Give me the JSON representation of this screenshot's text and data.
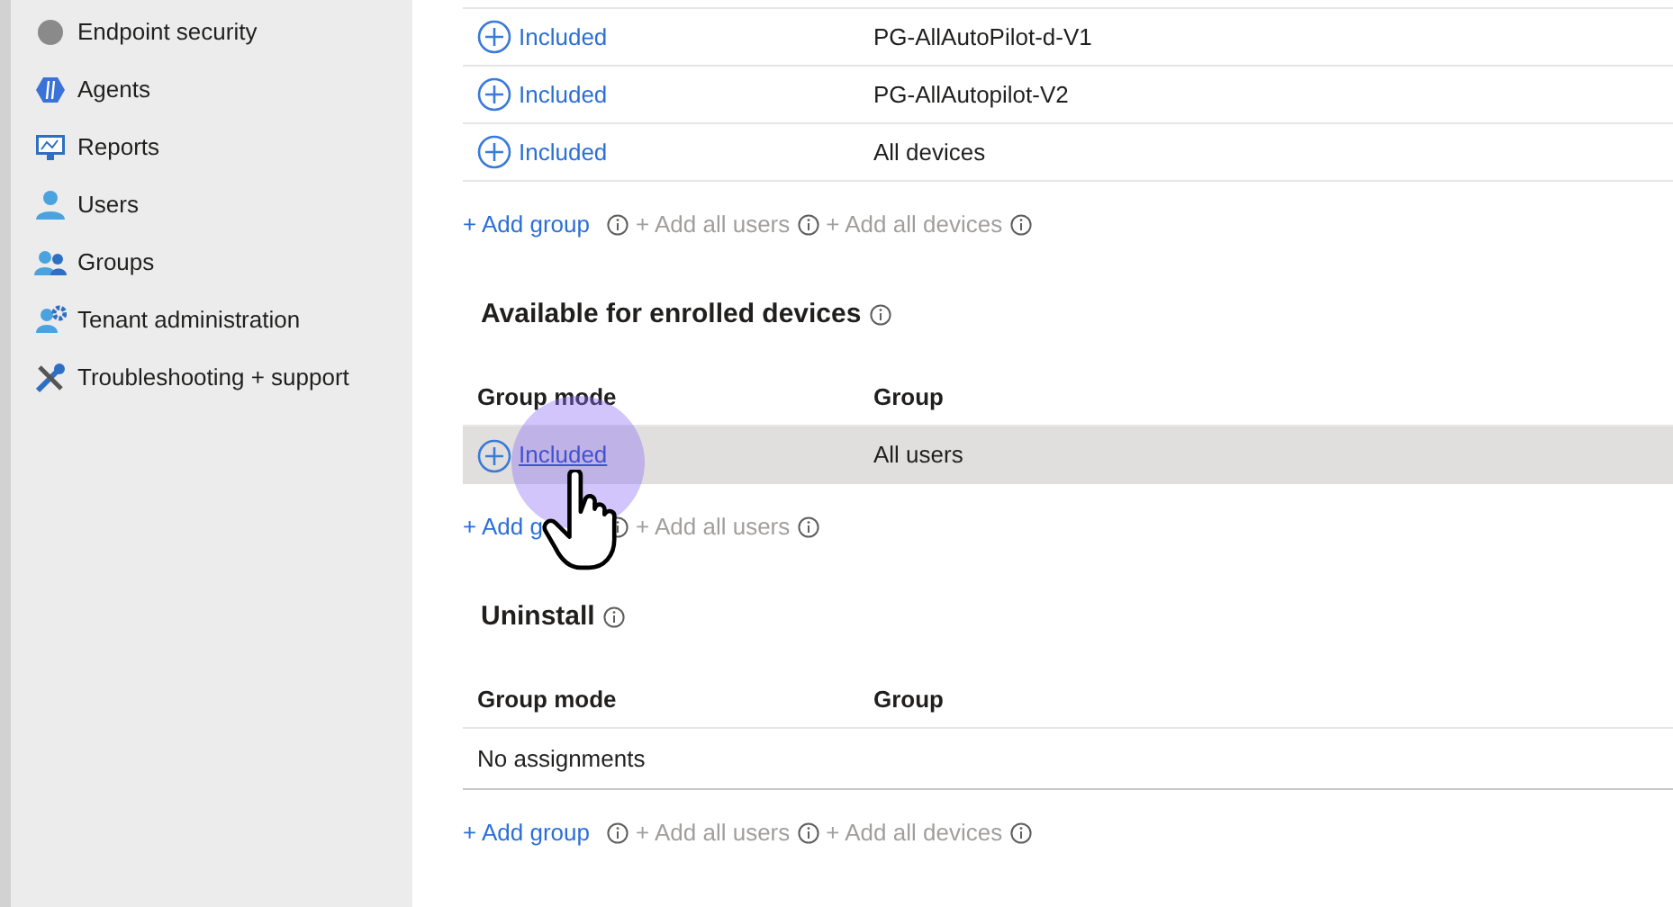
{
  "sidebar": {
    "items": [
      {
        "label": "Endpoint security"
      },
      {
        "label": "Agents"
      },
      {
        "label": "Reports"
      },
      {
        "label": "Users"
      },
      {
        "label": "Groups"
      },
      {
        "label": "Tenant administration"
      },
      {
        "label": "Troubleshooting + support"
      }
    ]
  },
  "sections": [
    {
      "rows": [
        {
          "mode": "Included",
          "group": "PG-AllAutoPilot-d-V1",
          "hovered": false
        },
        {
          "mode": "Included",
          "group": "PG-AllAutopilot-V2",
          "hovered": false
        },
        {
          "mode": "Included",
          "group": "All devices",
          "hovered": false
        }
      ],
      "actions": [
        {
          "label": "+ Add group",
          "disabled": false
        },
        {
          "label": "+ Add all users",
          "disabled": true
        },
        {
          "label": "+ Add all devices",
          "disabled": true
        }
      ]
    },
    {
      "title": "Available for enrolled devices",
      "columns": [
        "Group mode",
        "Group"
      ],
      "rows": [
        {
          "mode": "Included",
          "group": "All users",
          "hovered": true
        }
      ],
      "actions": [
        {
          "label": "+ Add g",
          "disabled": false
        },
        {
          "label": "+ Add all users",
          "disabled": true
        }
      ]
    },
    {
      "title": "Uninstall",
      "columns": [
        "Group mode",
        "Group"
      ],
      "empty_text": "No assignments",
      "actions": [
        {
          "label": "+ Add group",
          "disabled": false
        },
        {
          "label": "+ Add all users",
          "disabled": true
        },
        {
          "label": "+ Add all devices",
          "disabled": true
        }
      ]
    }
  ]
}
